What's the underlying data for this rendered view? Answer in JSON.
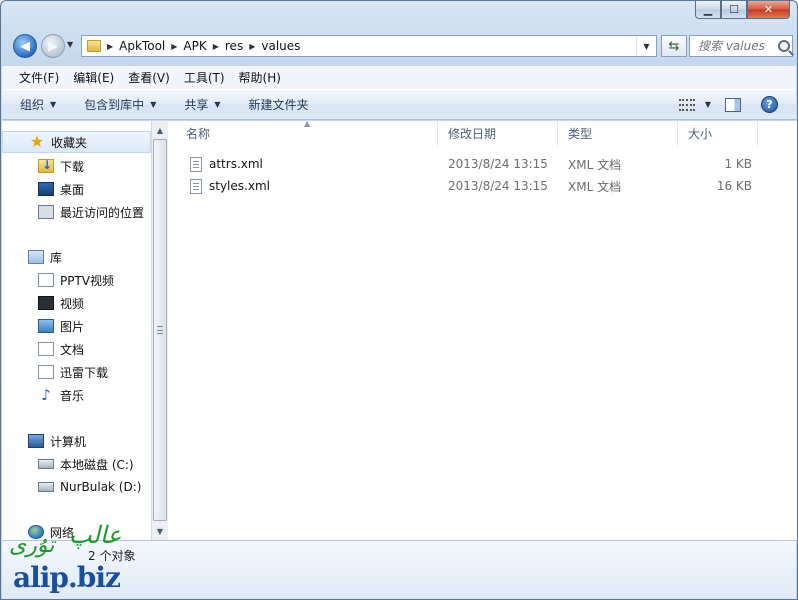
{
  "window": {
    "caption": {
      "minimize_glyph": "▁",
      "maximize_glyph": "☐",
      "close_glyph": "✕"
    }
  },
  "navigation": {
    "breadcrumb": [
      "ApkTool",
      "APK",
      "res",
      "values"
    ],
    "search": {
      "placeholder": "搜索 values"
    }
  },
  "menubar": {
    "items": [
      "文件(F)",
      "编辑(E)",
      "查看(V)",
      "工具(T)",
      "帮助(H)"
    ]
  },
  "commandbar": {
    "items": [
      "组织",
      "包含到库中",
      "共享",
      "新建文件夹"
    ]
  },
  "navpane": {
    "favorites": {
      "label": "收藏夹",
      "items": [
        "下载",
        "桌面",
        "最近访问的位置"
      ]
    },
    "libraries": {
      "label": "库",
      "items": [
        "PPTV视频",
        "视频",
        "图片",
        "文档",
        "迅雷下载",
        "音乐"
      ]
    },
    "computer": {
      "label": "计算机",
      "items": [
        "本地磁盘 (C:)",
        "NurBulak (D:)"
      ]
    },
    "network": {
      "label": "网络"
    }
  },
  "filelist": {
    "columns": [
      "名称",
      "修改日期",
      "类型",
      "大小"
    ],
    "rows": [
      {
        "name": "attrs.xml",
        "date": "2013/8/24 13:15",
        "type": "XML 文档",
        "size": "1 KB"
      },
      {
        "name": "styles.xml",
        "date": "2013/8/24 13:15",
        "type": "XML 文档",
        "size": "16 KB"
      }
    ]
  },
  "status": {
    "text": "2 个对象"
  },
  "watermark": {
    "arabic_top": "عالپ",
    "arabic_left": "تۇرى",
    "latin": "alip.biz"
  },
  "colors": {
    "accent": "#1e395b",
    "watermark_green": "#1b9a2a",
    "watermark_blue": "#1a4f9c"
  }
}
